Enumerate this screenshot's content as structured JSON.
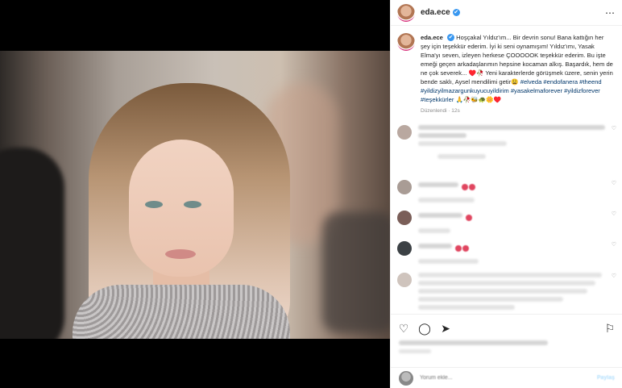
{
  "post": {
    "username": "eda.ece",
    "verified_badge": "✔",
    "more_icon": "⋯"
  },
  "caption": {
    "username": "eda.ece",
    "text": "Hoşçakal Yıldız'ım... Bir devrin sonu! Bana kattığın her şey için teşekkür ederim. İyi ki seni oynamışım! Yıldız'ımı, Yasak Elma'yı seven, izleyen herkese ÇOOOOOK teşekkür ederim. Bu işte emeği geçen arkadaşlarımın hepsine kocaman alkış. Başardık, hem de ne çok severek... ♥️🥀 Yeni karakterlerde görüşmek üzere, senin yerin bende saklı, Aysel mendilimi getir😩",
    "hashtags": "#elveda #endofanera #theend #yildizyilmazargunkuyucuyildirim #yasakelmaforever #yildizforever #teşekkürler 🙏🥀🐝🐢🌼♥️",
    "meta": "Düzenlendi · 12s"
  },
  "actions": {
    "like_icon": "♡",
    "comment_icon": "◯",
    "share_icon": "➤",
    "save_icon": "⚐"
  },
  "add_comment": {
    "placeholder": "Yorum ekle...",
    "post_label": "Paylaş"
  }
}
